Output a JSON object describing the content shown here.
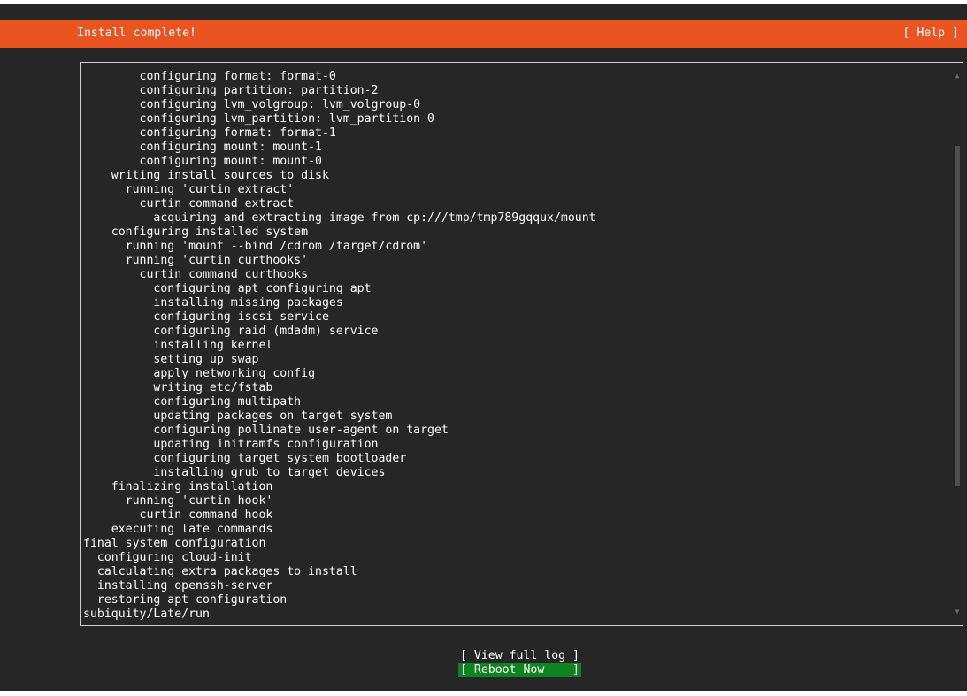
{
  "header": {
    "title": "Install complete!",
    "help_label": "[ Help ]",
    "accent_color": "#e95420"
  },
  "log": {
    "lines": [
      "        configuring format: format-0",
      "        configuring partition: partition-2",
      "        configuring lvm_volgroup: lvm_volgroup-0",
      "        configuring lvm_partition: lvm_partition-0",
      "        configuring format: format-1",
      "        configuring mount: mount-1",
      "        configuring mount: mount-0",
      "    writing install sources to disk",
      "      running 'curtin extract'",
      "        curtin command extract",
      "          acquiring and extracting image from cp:///tmp/tmp789gqqux/mount",
      "    configuring installed system",
      "      running 'mount --bind /cdrom /target/cdrom'",
      "      running 'curtin curthooks'",
      "        curtin command curthooks",
      "          configuring apt configuring apt",
      "          installing missing packages",
      "          configuring iscsi service",
      "          configuring raid (mdadm) service",
      "          installing kernel",
      "          setting up swap",
      "          apply networking config",
      "          writing etc/fstab",
      "          configuring multipath",
      "          updating packages on target system",
      "          configuring pollinate user-agent on target",
      "          updating initramfs configuration",
      "          configuring target system bootloader",
      "          installing grub to target devices",
      "    finalizing installation",
      "      running 'curtin hook'",
      "        curtin command hook",
      "    executing late commands",
      "final system configuration",
      "  configuring cloud-init",
      "  calculating extra packages to install",
      "  installing openssh-server",
      "  restoring apt configuration",
      "subiquity/Late/run"
    ]
  },
  "scrollbar": {
    "up_icon": "▲",
    "down_icon": "▼",
    "position_fraction": 0.35
  },
  "actions": {
    "view_log_label": "[ View full log ]",
    "reboot_label": "[ Reboot Now    ]",
    "focus_color": "#0e8420"
  }
}
